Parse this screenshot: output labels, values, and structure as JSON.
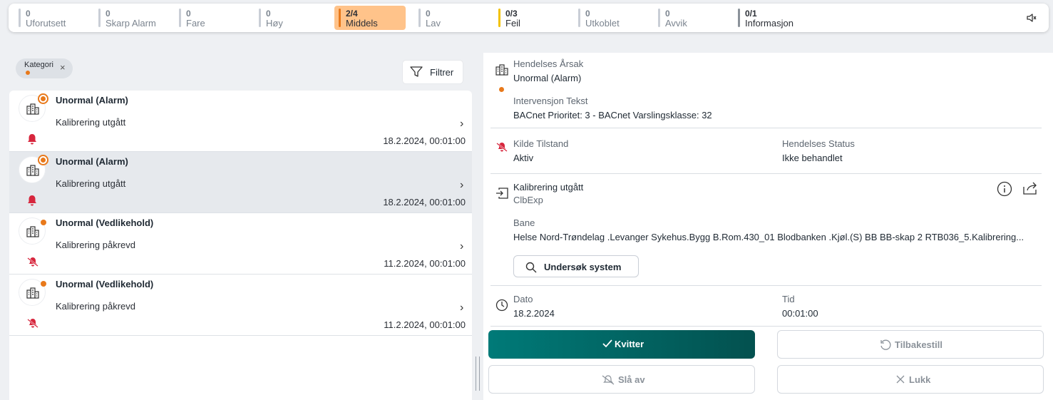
{
  "statusbar": {
    "categories": [
      {
        "count": "0",
        "label": "Uforutsett"
      },
      {
        "count": "0",
        "label": "Skarp Alarm"
      },
      {
        "count": "0",
        "label": "Fare"
      },
      {
        "count": "0",
        "label": "Høy"
      },
      {
        "count": "2/4",
        "label": "Middels"
      },
      {
        "count": "0",
        "label": "Lav"
      },
      {
        "count": "0/3",
        "label": "Feil"
      },
      {
        "count": "0",
        "label": "Utkoblet"
      },
      {
        "count": "0",
        "label": "Avvik"
      },
      {
        "count": "0/1",
        "label": "Informasjon"
      }
    ],
    "active_category": "Middels",
    "mute_icon": "speaker-muted-icon"
  },
  "filter": {
    "chip_label": "Kategori",
    "chip_close": "×",
    "button_label": "Filtrer"
  },
  "events": [
    {
      "title": "Unormal (Alarm)",
      "description": "Kalibrering utgått",
      "date": "18.2.2024, 00:01:00",
      "chevron": "›",
      "selected": false
    },
    {
      "title": "Unormal (Alarm)",
      "description": "Kalibrering utgått",
      "date": "18.2.2024, 00:01:00",
      "chevron": "›",
      "selected": true
    },
    {
      "title": "Unormal (Vedlikehold)",
      "description": "Kalibrering påkrevd",
      "date": "11.2.2024, 00:01:00",
      "chevron": "›",
      "selected": false
    },
    {
      "title": "Unormal (Vedlikehold)",
      "description": "Kalibrering påkrevd",
      "date": "11.2.2024, 00:01:00",
      "chevron": "›",
      "selected": false
    }
  ],
  "detail": {
    "cause_label": "Hendelses Årsak",
    "cause_value": "Unormal (Alarm)",
    "intervention_label": "Intervensjon Tekst",
    "intervention_value": "BACnet Prioritet: 3 - BACnet Varslingsklasse: 32",
    "source_state_label": "Kilde Tilstand",
    "source_state_value": "Aktiv",
    "event_status_label": "Hendelses Status",
    "event_status_value": "Ikke behandlet",
    "point_name": "Kalibrering utgått",
    "point_id": "ClbExp",
    "path_label": "Bane",
    "path_value": "Helse Nord-Trøndelag .Levanger Sykehus.Bygg B.Rom.430_01 Blodbanken .Kjøl.(S) BB BB-skap 2 RTB036_5.Kalibrering...",
    "investigate_label": "Undersøk system",
    "date_label": "Dato",
    "date_value": "18.2.2024",
    "time_label": "Tid",
    "time_value": "00:01:00"
  },
  "actions": {
    "acknowledge": "Kvitter",
    "reset": "Tilbakestill",
    "silence": "Slå av",
    "close": "Lukk"
  },
  "colors": {
    "accent_orange": "#e8791b",
    "active_category_bg": "#ffc38a",
    "primary_button": "#007a78",
    "alarm_red": "#d7263d"
  }
}
